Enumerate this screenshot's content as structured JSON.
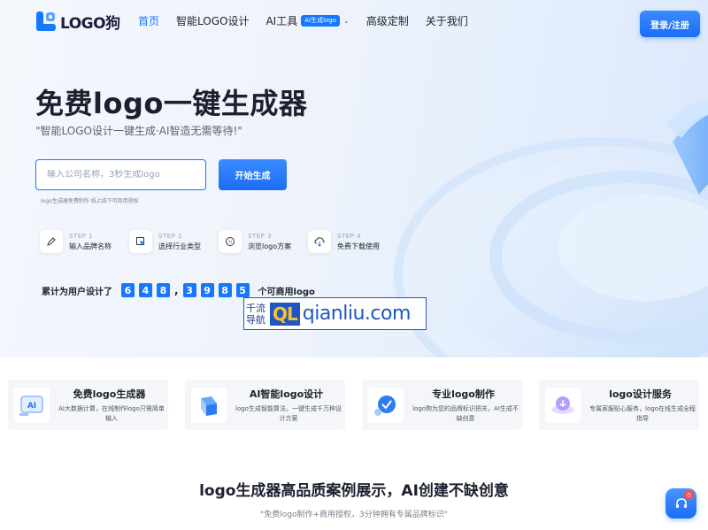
{
  "brand": {
    "logo_text": "LOGO狗"
  },
  "nav": {
    "items": [
      {
        "label": "首页",
        "active": true
      },
      {
        "label": "智能LOGO设计"
      },
      {
        "label": "AI工具",
        "badge": "AI生成logo",
        "dropdown": true
      },
      {
        "label": "高级定制"
      },
      {
        "label": "关于我们"
      }
    ],
    "login_label": "登录/注册"
  },
  "hero": {
    "title": "免费logo一键生成器",
    "subtitle": "\"智能LOGO设计一键生成·AI智造无需等待!\"",
    "search_placeholder": "输入公司名称，3秒生成logo",
    "start_label": "开始生成",
    "hint": "logo生成器免费制作 线上线下可商用授权"
  },
  "steps": [
    {
      "num": "STEP 1",
      "label": "输入品牌名称",
      "icon": "pen-icon"
    },
    {
      "num": "STEP 2",
      "label": "选择行业类型",
      "icon": "cursor-icon"
    },
    {
      "num": "STEP 3",
      "label": "浏览logo方案",
      "icon": "ai-chip-icon"
    },
    {
      "num": "STEP 4",
      "label": "免费下载使用",
      "icon": "cloud-download-icon"
    }
  ],
  "counter": {
    "prefix": "累计为用户设计了",
    "d1": "6",
    "d2": "4",
    "d3": "8",
    "comma": ",",
    "d4": "3",
    "d5": "9",
    "d6": "8",
    "d7": "5",
    "suffix": "个可商用logo"
  },
  "watermark": {
    "cn_line1": "千流",
    "cn_line2": "导航",
    "mark": "QL",
    "domain": "qianliu.com"
  },
  "features": [
    {
      "title": "免费logo生成器",
      "desc": "AI大数据计算，在线制作logo只需简单输入",
      "icon": "ai-screen-icon"
    },
    {
      "title": "AI智能logo设计",
      "desc": "logo生成智能算法，一键生成千万种设计方案",
      "icon": "design-cube-icon"
    },
    {
      "title": "专业logo制作",
      "desc": "logo狗为您的品牌标识把关，AI生成不缺创意",
      "icon": "brand-shield-icon"
    },
    {
      "title": "logo设计服务",
      "desc": "专属客服贴心服务，logo在线生成全程指导",
      "icon": "service-download-icon"
    }
  ],
  "section": {
    "title": "logo生成器高品质案例展示，AI创建不缺创意",
    "subtitle": "\"免费logo制作+商用授权，3分钟拥有专属品牌标识\""
  },
  "support": {
    "badge": "0",
    "icon": "headset-icon"
  },
  "colors": {
    "accent": "#1677ff",
    "text": "#1d2129"
  }
}
